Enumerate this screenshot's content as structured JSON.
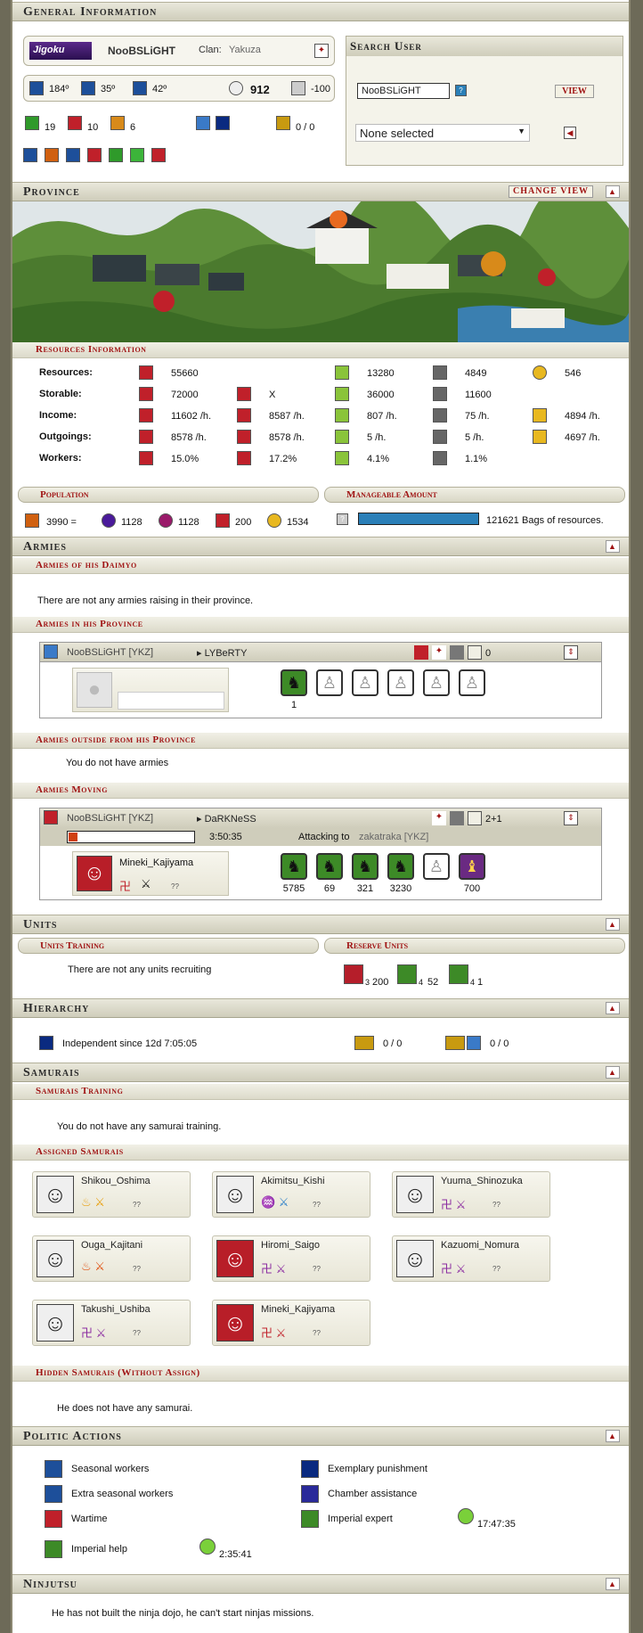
{
  "general": {
    "title": "General Information",
    "clan_badge": "Jigoku",
    "player_name": "NooBSLiGHT",
    "clan_label": "Clan:",
    "clan_name": "Yakuza",
    "stats": [
      "184º",
      "35º",
      "42º",
      "912",
      "-100"
    ],
    "counts": [
      "19",
      "10",
      "6"
    ],
    "ratio": "0 / 0"
  },
  "search": {
    "title": "Search User",
    "input_value": "NooBSLiGHT",
    "view_label": "VIEW",
    "select_value": "None selected"
  },
  "province": {
    "title": "Province",
    "change_view": "CHANGE VIEW"
  },
  "resources": {
    "title": "Resources Information",
    "rows": [
      {
        "label": "Resources:",
        "v1": "55660",
        "v2": "",
        "v3": "13280",
        "v4": "4849",
        "v5": "546"
      },
      {
        "label": "Storable:",
        "v1": "72000",
        "v2": "X",
        "v3": "36000",
        "v4": "11600",
        "v5": ""
      },
      {
        "label": "Income:",
        "v1": "11602 /h.",
        "v2": "8587 /h.",
        "v3": "807 /h.",
        "v4": "75 /h.",
        "v5": "4894 /h."
      },
      {
        "label": "Outgoings:",
        "v1": "8578 /h.",
        "v2": "8578 /h.",
        "v3": "5 /h.",
        "v4": "5 /h.",
        "v5": "4697 /h."
      },
      {
        "label": "Workers:",
        "v1": "15.0%",
        "v2": "17.2%",
        "v3": "4.1%",
        "v4": "1.1%",
        "v5": ""
      }
    ]
  },
  "population": {
    "title": "Population",
    "total": "3990 =",
    "values": [
      "1128",
      "1128",
      "200",
      "1534"
    ]
  },
  "manageable": {
    "title": "Manageable Amount",
    "fill_fraction": 1.0,
    "value": "121621",
    "suffix": "Bags of resources."
  },
  "armies": {
    "title": "Armies",
    "daimyo_title": "Armies of his Daimyo",
    "daimyo_text": "There are not any armies raising in their province.",
    "province_title": "Armies in his Province",
    "province_army": {
      "owner": "NooBSLiGHT [YKZ]",
      "name": "LYBeRTY",
      "count": "0",
      "first_unit_count": "1"
    },
    "outside_title": "Armies outside from his Province",
    "outside_text": "You do not have armies",
    "moving_title": "Armies Moving",
    "moving_army": {
      "owner": "NooBSLiGHT [YKZ]",
      "name": "DaRKNeSS",
      "count": "2+1",
      "timer": "3:50:35",
      "attacking_label": "Attacking to",
      "target": "zakatraka [YKZ]",
      "samurai": "Mineki_Kajiyama",
      "units": [
        "5785",
        "69",
        "321",
        "3230",
        "",
        "700"
      ],
      "unit_badges": [
        "4",
        "1",
        "2",
        "4",
        "",
        "1"
      ]
    }
  },
  "units": {
    "title": "Units",
    "training_title": "Units Training",
    "reserve_title": "Reserve Units",
    "training_text": "There are not any units recruiting",
    "reserve": [
      {
        "badge": "3",
        "count": "200"
      },
      {
        "badge": "4",
        "count": "52"
      },
      {
        "badge": "4",
        "count": "1"
      }
    ]
  },
  "hierarchy": {
    "title": "Hierarchy",
    "text": "Independent since 12d  7:05:05",
    "r1": "0 / 0",
    "r2": "0 / 0"
  },
  "samurais": {
    "title": "Samurais",
    "training_title": "Samurais Training",
    "training_text": "You do not have any samurai training.",
    "assigned_title": "Assigned Samurais",
    "assigned": [
      "Shikou_Oshima",
      "Akimitsu_Kishi",
      "Yuuma_Shinozuka",
      "Ouga_Kajitani",
      "Hiromi_Saigo",
      "Kazuomi_Nomura",
      "Takushi_Ushiba",
      "Mineki_Kajiyama"
    ],
    "level": "??",
    "hidden_title": "Hidden Samurais (Without Assign)",
    "hidden_text": "He does not have any samurai."
  },
  "politic": {
    "title": "Politic Actions",
    "actions": [
      "Seasonal workers",
      "Exemplary punishment",
      "Extra seasonal workers",
      "Chamber assistance",
      "Wartime",
      "Imperial expert",
      "Imperial help"
    ],
    "timer1": "17:47:35",
    "timer2": "2:35:41"
  },
  "ninjutsu": {
    "title": "Ninjutsu",
    "text": "He has not built the ninja dojo, he can't start ninjas missions."
  },
  "colors": {
    "accent": "#a01414",
    "bar": "#2a7fb8"
  }
}
